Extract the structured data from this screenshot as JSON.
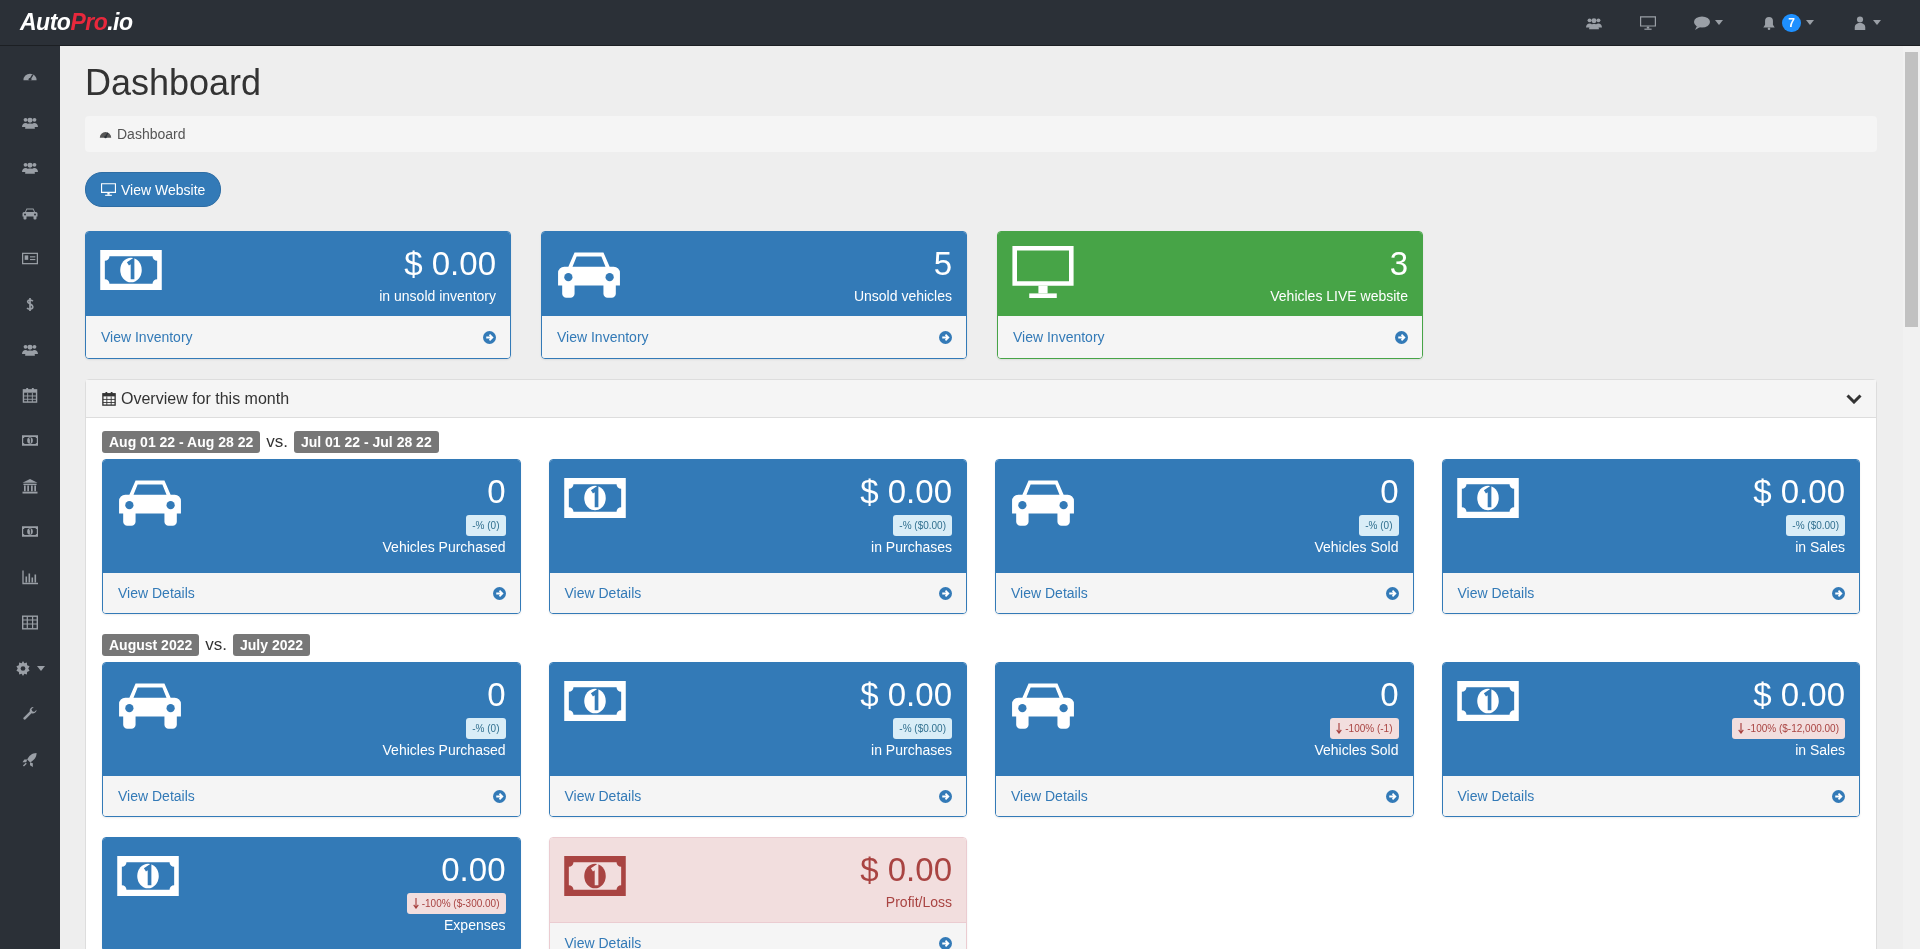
{
  "topbar": {
    "logo": [
      "Auto",
      "Pro",
      ".io"
    ],
    "notification_count": "7"
  },
  "page": {
    "title": "Dashboard",
    "breadcrumb": "Dashboard",
    "view_website_button": "View Website"
  },
  "summary_cards": [
    {
      "kind": "money",
      "color": "#337ab7",
      "value": "$ 0.00",
      "label": "in unsold inventory",
      "link": "View Inventory"
    },
    {
      "kind": "car",
      "color": "#337ab7",
      "value": "5",
      "label": "Unsold vehicles",
      "link": "View Inventory"
    },
    {
      "kind": "monitor",
      "color": "#47a447",
      "value": "3",
      "label": "Vehicles LIVE website",
      "link": "View Inventory"
    }
  ],
  "overview": {
    "title": "Overview for this month",
    "expanded": true,
    "sections": [
      {
        "period": "Aug 01 22 - Aug 28 22",
        "separator": "vs.",
        "comparison": "Jul 01 22 - Jul 28 22",
        "cards": [
          {
            "kind": "car",
            "color": "#337ab7",
            "value": "0",
            "change": {
              "text": "-% (0)",
              "down": false
            },
            "label": "Vehicles Purchased",
            "link": "View Details"
          },
          {
            "kind": "money",
            "color": "#337ab7",
            "value": "$ 0.00",
            "change": {
              "text": "-% ($0.00)",
              "down": false
            },
            "label": "in Purchases",
            "link": "View Details"
          },
          {
            "kind": "car",
            "color": "#337ab7",
            "value": "0",
            "change": {
              "text": "-% (0)",
              "down": false
            },
            "label": "Vehicles Sold",
            "link": "View Details"
          },
          {
            "kind": "money",
            "color": "#337ab7",
            "value": "$ 0.00",
            "change": {
              "text": "-% ($0.00)",
              "down": false
            },
            "label": "in Sales",
            "link": "View Details"
          }
        ]
      },
      {
        "period": "August 2022",
        "separator": "vs.",
        "comparison": "July 2022",
        "cards": [
          {
            "kind": "car",
            "color": "#337ab7",
            "value": "0",
            "change": {
              "text": "-% (0)",
              "down": false
            },
            "label": "Vehicles Purchased",
            "link": "View Details"
          },
          {
            "kind": "money",
            "color": "#337ab7",
            "value": "$ 0.00",
            "change": {
              "text": "-% ($0.00)",
              "down": false
            },
            "label": "in Purchases",
            "link": "View Details"
          },
          {
            "kind": "car",
            "color": "#337ab7",
            "value": "0",
            "change": {
              "text": "-100% (-1)",
              "down": true
            },
            "label": "Vehicles Sold",
            "link": "View Details"
          },
          {
            "kind": "money",
            "color": "#337ab7",
            "value": "$ 0.00",
            "change": {
              "text": "-100% ($-12,000.00)",
              "down": true
            },
            "label": "in Sales",
            "link": "View Details"
          }
        ]
      },
      {
        "cards": [
          {
            "kind": "money",
            "color": "#337ab7",
            "value": "0.00",
            "change": {
              "text": "-100% ($-300.00)",
              "down": true
            },
            "label": "Expenses"
          },
          {
            "kind": "money",
            "color": "#f2dede",
            "value": "$ 0.00",
            "label": "Profit/Loss",
            "link": "View Details"
          }
        ]
      }
    ]
  }
}
